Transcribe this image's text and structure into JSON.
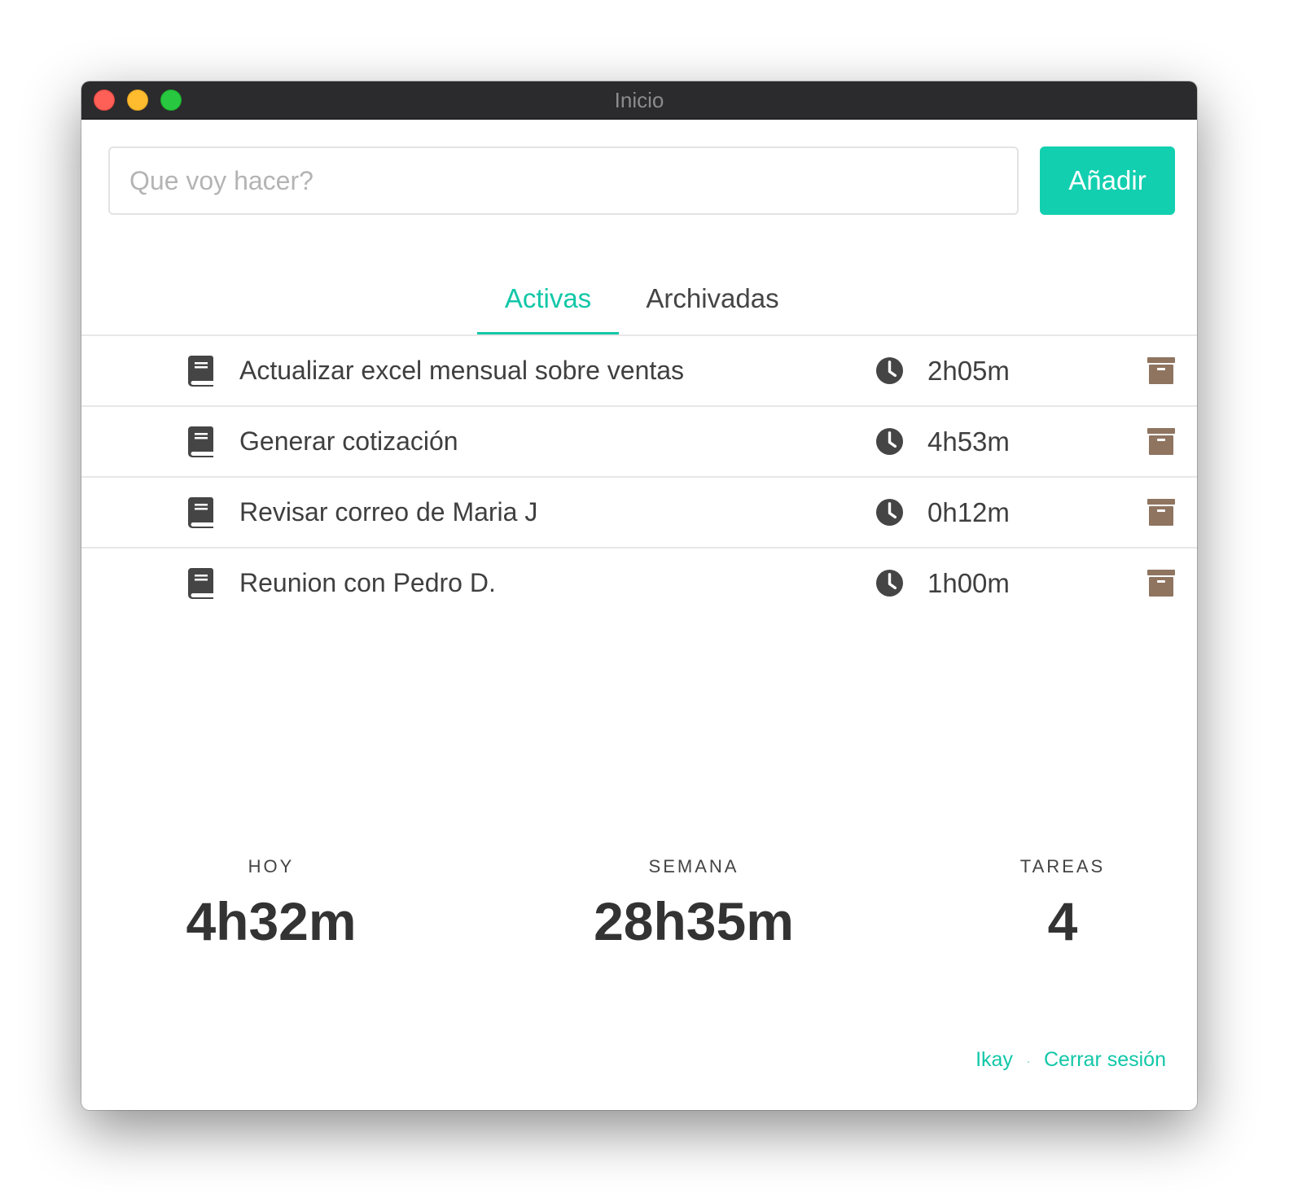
{
  "window": {
    "title": "Inicio"
  },
  "task_form": {
    "input_value": "",
    "input_placeholder": "Que voy hacer?",
    "add_label": "Añadir"
  },
  "tabs": [
    {
      "label": "Activas",
      "active": true
    },
    {
      "label": "Archivadas",
      "active": false
    }
  ],
  "tasks": [
    {
      "icon": "book-icon",
      "title": "Actualizar excel mensual sobre ventas",
      "time": "2h05m"
    },
    {
      "icon": "book-icon",
      "title": "Generar cotización",
      "time": "4h53m"
    },
    {
      "icon": "book-icon",
      "title": "Revisar correo de Maria J",
      "time": "0h12m"
    },
    {
      "icon": "book-icon",
      "title": "Reunion con Pedro D.",
      "time": "1h00m"
    }
  ],
  "stats": {
    "today_label": "HOY",
    "today_value": "4h32m",
    "week_label": "SEMANA",
    "week_value": "28h35m",
    "tasks_label": "TAREAS",
    "tasks_value": "4"
  },
  "footer": {
    "user": "Ikay",
    "separator": "·",
    "logout": "Cerrar sesión"
  },
  "colors": {
    "accent": "#12cfb0",
    "archive_icon": "#8f7460",
    "icon_dark": "#454545",
    "titlebar": "#2b2b2d"
  }
}
